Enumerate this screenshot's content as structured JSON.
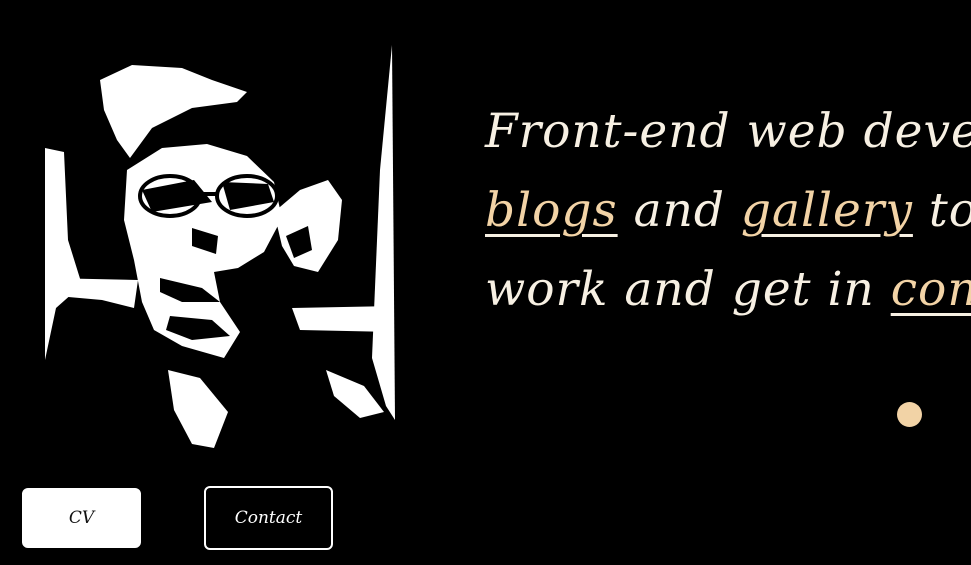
{
  "hero": {
    "line1": "Front-end web develop",
    "line2_link1": "blogs",
    "line2_mid": " and ",
    "line2_link2": "gallery",
    "line2_end": " to k",
    "line3_start": "work and get in ",
    "line3_link": "cont"
  },
  "buttons": {
    "cv_label": "CV",
    "contact_label": "Contact"
  },
  "colors": {
    "background": "#000000",
    "text": "#f7f0e3",
    "accent": "#f2d3a6"
  }
}
